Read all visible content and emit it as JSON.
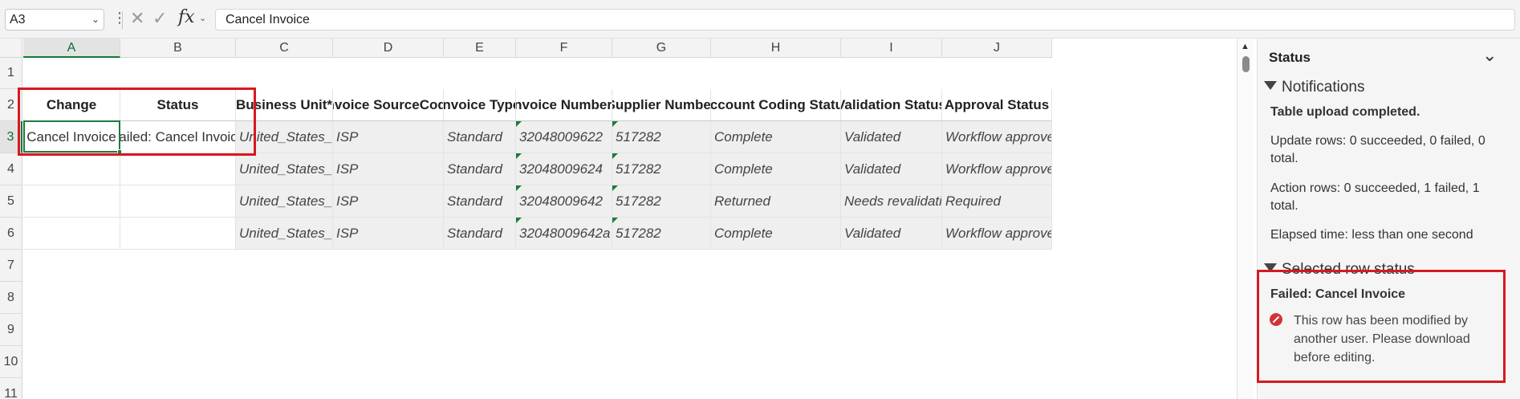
{
  "formula_bar": {
    "name_box": "A3",
    "fx": "fx",
    "content": "Cancel Invoice"
  },
  "grid": {
    "columns": [
      {
        "letter": "A"
      },
      {
        "letter": "B"
      },
      {
        "letter": "C"
      },
      {
        "letter": "D"
      },
      {
        "letter": "E"
      },
      {
        "letter": "F"
      },
      {
        "letter": "G"
      },
      {
        "letter": "H"
      },
      {
        "letter": "I"
      },
      {
        "letter": "J"
      }
    ],
    "row_numbers": [
      "1",
      "2",
      "3",
      "4",
      "5",
      "6",
      "7",
      "8",
      "9",
      "10",
      "11"
    ],
    "headers": [
      "Change",
      "Status",
      "Business Unit*",
      "Invoice SourceCode",
      "Invoice Type",
      "Invoice Number*",
      "Supplier Number",
      "Account Coding Status",
      "Validation Status",
      "Approval Status"
    ],
    "rows": [
      [
        "Cancel Invoice",
        "Failed: Cancel Invoice",
        "United_States_BU",
        "ISP",
        "Standard",
        "32048009622",
        "517282",
        "Complete",
        "Validated",
        "Workflow approved"
      ],
      [
        "",
        "",
        "United_States_BU",
        "ISP",
        "Standard",
        "32048009624",
        "517282",
        "Complete",
        "Validated",
        "Workflow approved"
      ],
      [
        "",
        "",
        "United_States_BU",
        "ISP",
        "Standard",
        "32048009642",
        "517282",
        "Returned",
        "Needs revalidation",
        "Required"
      ],
      [
        "",
        "",
        "United_States_BU",
        "ISP",
        "Standard",
        "32048009642a",
        "517282",
        "Complete",
        "Validated",
        "Workflow approved"
      ]
    ]
  },
  "pane": {
    "title": "Status",
    "notifications": {
      "heading": "Notifications",
      "upload": "Table upload completed.",
      "update_rows": "Update rows:  0 succeeded, 0 failed, 0 total.",
      "action_rows": "Action rows: 0 succeeded, 1 failed, 1 total.",
      "elapsed": "Elapsed time: less than one second"
    },
    "selected": {
      "heading": "Selected row status",
      "title": "Failed: Cancel Invoice",
      "message": "This row has been modified by another user. Please download before editing."
    }
  },
  "colors": {
    "error_red": "#d71920",
    "selection_green": "#1f7a3e"
  }
}
